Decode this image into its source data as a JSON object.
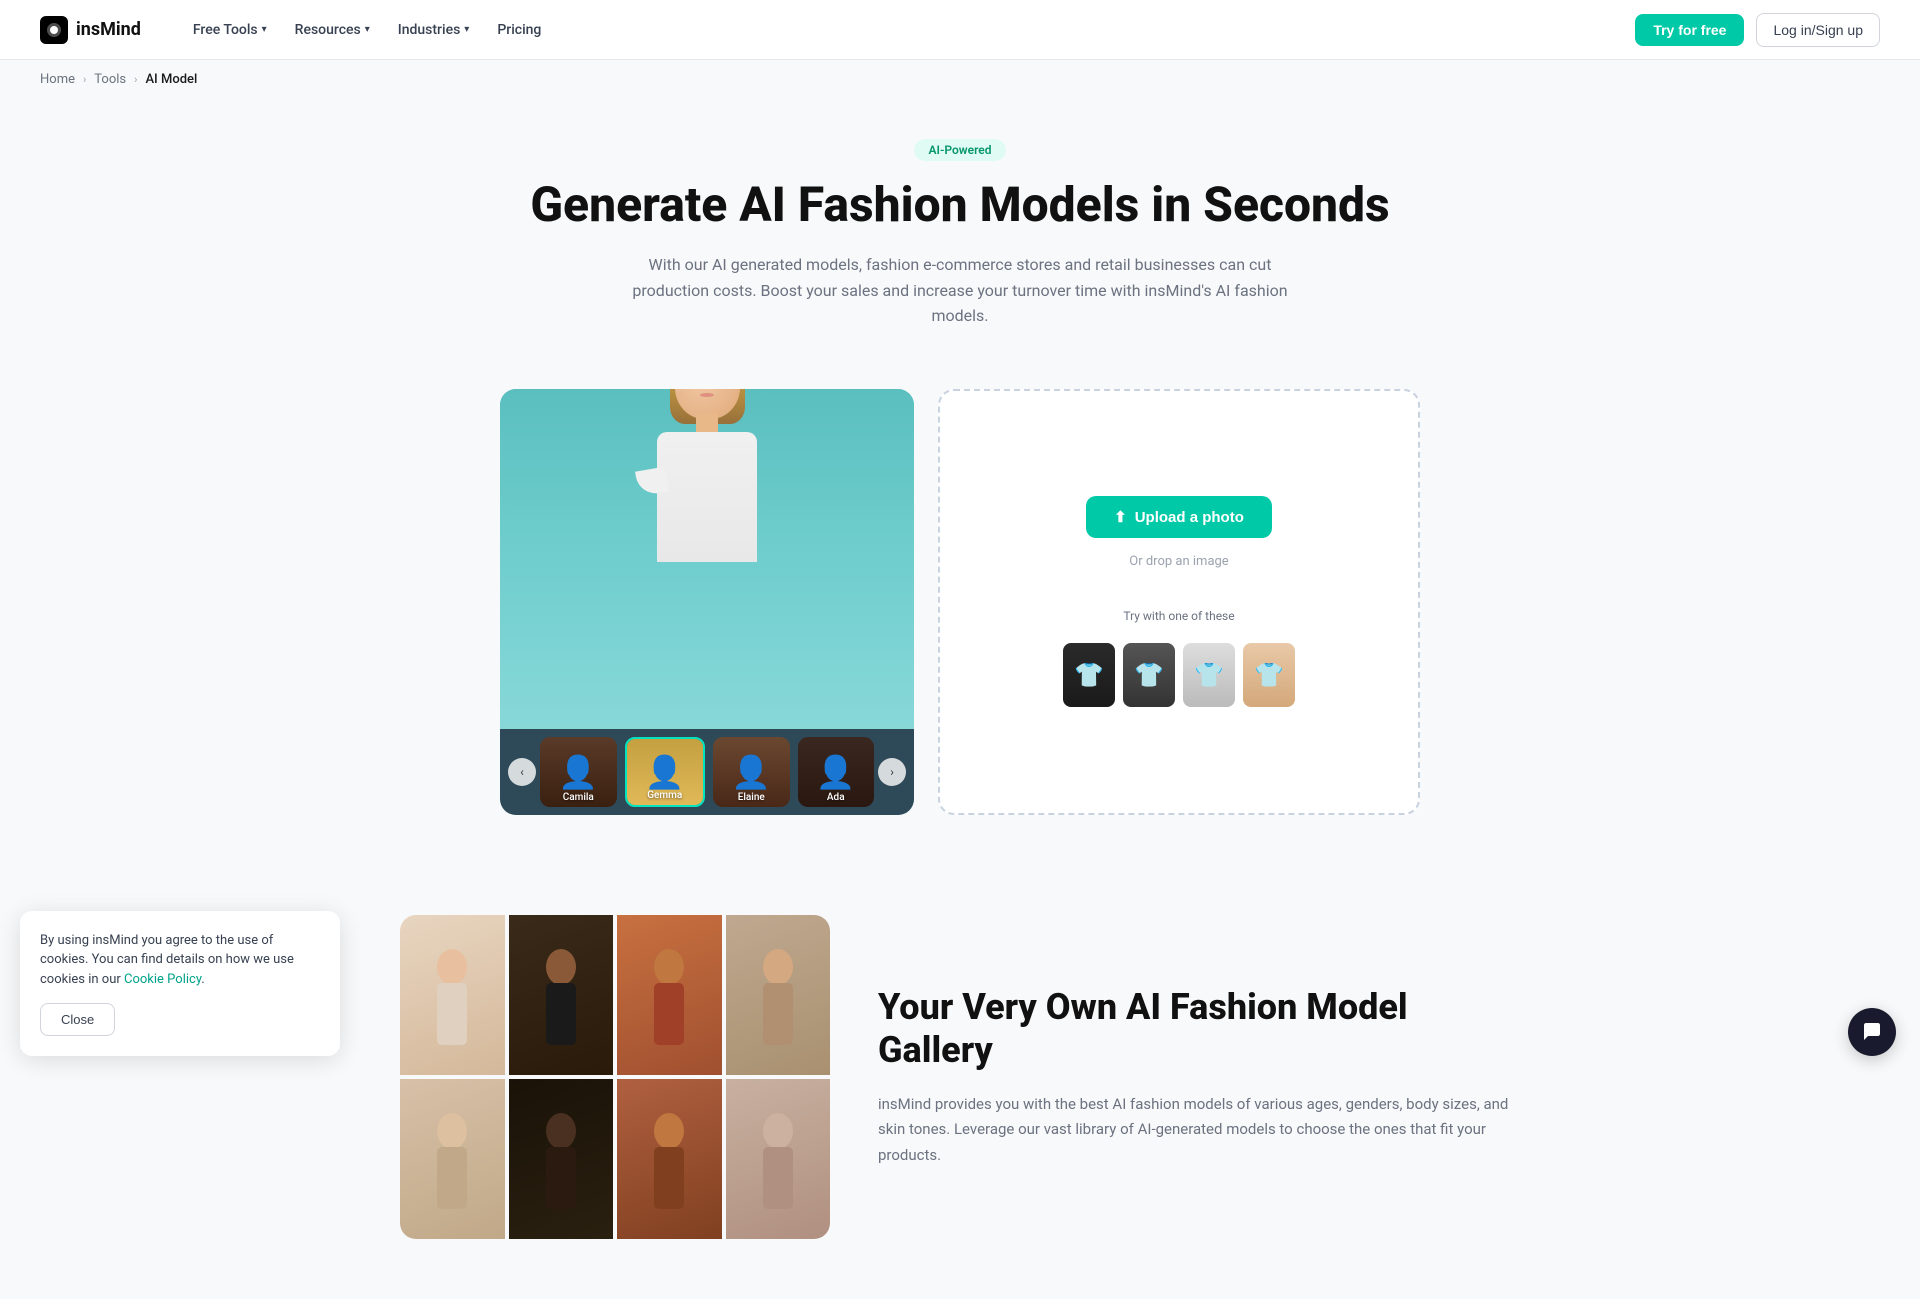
{
  "brand": {
    "name": "insMind",
    "logo_text": "ins"
  },
  "nav": {
    "items": [
      {
        "id": "free-tools",
        "label": "Free Tools",
        "has_dropdown": true
      },
      {
        "id": "resources",
        "label": "Resources",
        "has_dropdown": true
      },
      {
        "id": "industries",
        "label": "Industries",
        "has_dropdown": true
      },
      {
        "id": "pricing",
        "label": "Pricing",
        "has_dropdown": false
      }
    ],
    "try_button": "Try for free",
    "login_button": "Log in/Sign up"
  },
  "breadcrumb": {
    "items": [
      "Home",
      "Tools",
      "AI Model"
    ]
  },
  "hero": {
    "badge": "AI-Powered",
    "title": "Generate AI Fashion Models in Seconds",
    "description": "With our AI generated models, fashion e-commerce stores and retail businesses can cut production costs. Boost your sales and increase your turnover time with insMind's AI fashion models."
  },
  "upload_panel": {
    "button_label": "Upload a photo",
    "drop_label": "Or drop an image",
    "try_label": "Try with one of these",
    "sample_colors": [
      "dark",
      "mid-dark",
      "light",
      "nude"
    ]
  },
  "model_selector": {
    "models": [
      {
        "name": "Camila",
        "active": false
      },
      {
        "name": "Gemma",
        "active": true
      },
      {
        "name": "Elaine",
        "active": false
      },
      {
        "name": "Ada",
        "active": false
      }
    ]
  },
  "section2": {
    "title": "Your Very Own AI Fashion Model Gallery",
    "description": "insMind provides you with the best AI fashion models of various ages, genders, body sizes, and skin tones. Leverage our vast library of AI-generated models to choose the ones that fit your products."
  },
  "cookie": {
    "text": "By using insMind you agree to the use of cookies. You can find details on how we use cookies in our",
    "link_text": "Cookie Policy",
    "close_button": "Close"
  }
}
